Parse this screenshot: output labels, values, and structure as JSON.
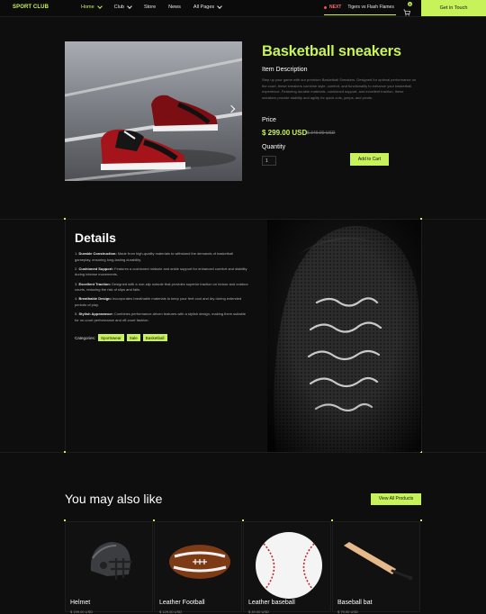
{
  "nav": {
    "brand": "SPORT CLUB",
    "items": [
      {
        "label": "Home",
        "has_dropdown": true,
        "active": true
      },
      {
        "label": "Club",
        "has_dropdown": true,
        "active": false
      },
      {
        "label": "Store",
        "has_dropdown": false,
        "active": false
      },
      {
        "label": "News",
        "has_dropdown": false,
        "active": false
      },
      {
        "label": "All Pages",
        "has_dropdown": true,
        "active": false
      }
    ],
    "next_label": "NEXT",
    "next_match": "Tigers vs Flash Flames",
    "cart_count": "0",
    "cta": "Get in Touch"
  },
  "product": {
    "title": "Basketball sneakers",
    "desc_heading": "Item Description",
    "description": "Step up your game with our premium Basketball Sneakers. Designed for optimal performance on the court, these sneakers combine style, comfort, and functionality to enhance your basketball experience. Featuring durable materials, cushioned support, and excellent traction, these sneakers provide stability and agility for quick cuts, jumps, and pivots.",
    "price_label": "Price",
    "price": "$ 299.00 USD",
    "old_price": "$ 349.00 USD",
    "quantity_label": "Quantity",
    "quantity": "1",
    "add_to_cart": "Add to Cart"
  },
  "details": {
    "title": "Details",
    "items": [
      {
        "num": "1.",
        "head": "Durable Construction:",
        "text": " Made from high-quality materials to withstand the demands of basketball gameplay, ensuring long-lasting durability."
      },
      {
        "num": "2.",
        "head": "Cushioned Support:",
        "text": " Features a cushioned midsole and ankle support for enhanced comfort and stability during intense movements."
      },
      {
        "num": "3.",
        "head": "Excellent Traction:",
        "text": " Designed with a non-slip outsole that provides superior traction on indoor and outdoor courts, reducing the risk of slips and falls."
      },
      {
        "num": "4.",
        "head": "Breathable Design:",
        "text": " Incorporates breathable materials to keep your feet cool and dry during extended periods of play."
      },
      {
        "num": "5.",
        "head": "Stylish Appearance:",
        "text": " Combines performance-driven features with a stylish design, making them suitable for on-court performance and off-court fashion."
      }
    ],
    "categories_label": "Categories:",
    "categories": [
      "Sportswear",
      "Sale",
      "Basketball"
    ]
  },
  "related": {
    "title": "You may also like",
    "view_all": "View All Products",
    "products": [
      {
        "name": "Helmet",
        "price": "$ 199.00 USD",
        "icon": "helmet-image"
      },
      {
        "name": "Leather Football",
        "price": "$ 129.00 USD",
        "icon": "football-image"
      },
      {
        "name": "Leather baseball",
        "price": "$ 49.00 USD",
        "icon": "baseball-image"
      },
      {
        "name": "Baseball bat",
        "price": "$ 79.00 USD",
        "icon": "baseball-bat-image"
      }
    ]
  },
  "colors": {
    "accent": "#c8f25a",
    "background": "#0e0e0e",
    "muted": "#7a7a7a"
  }
}
